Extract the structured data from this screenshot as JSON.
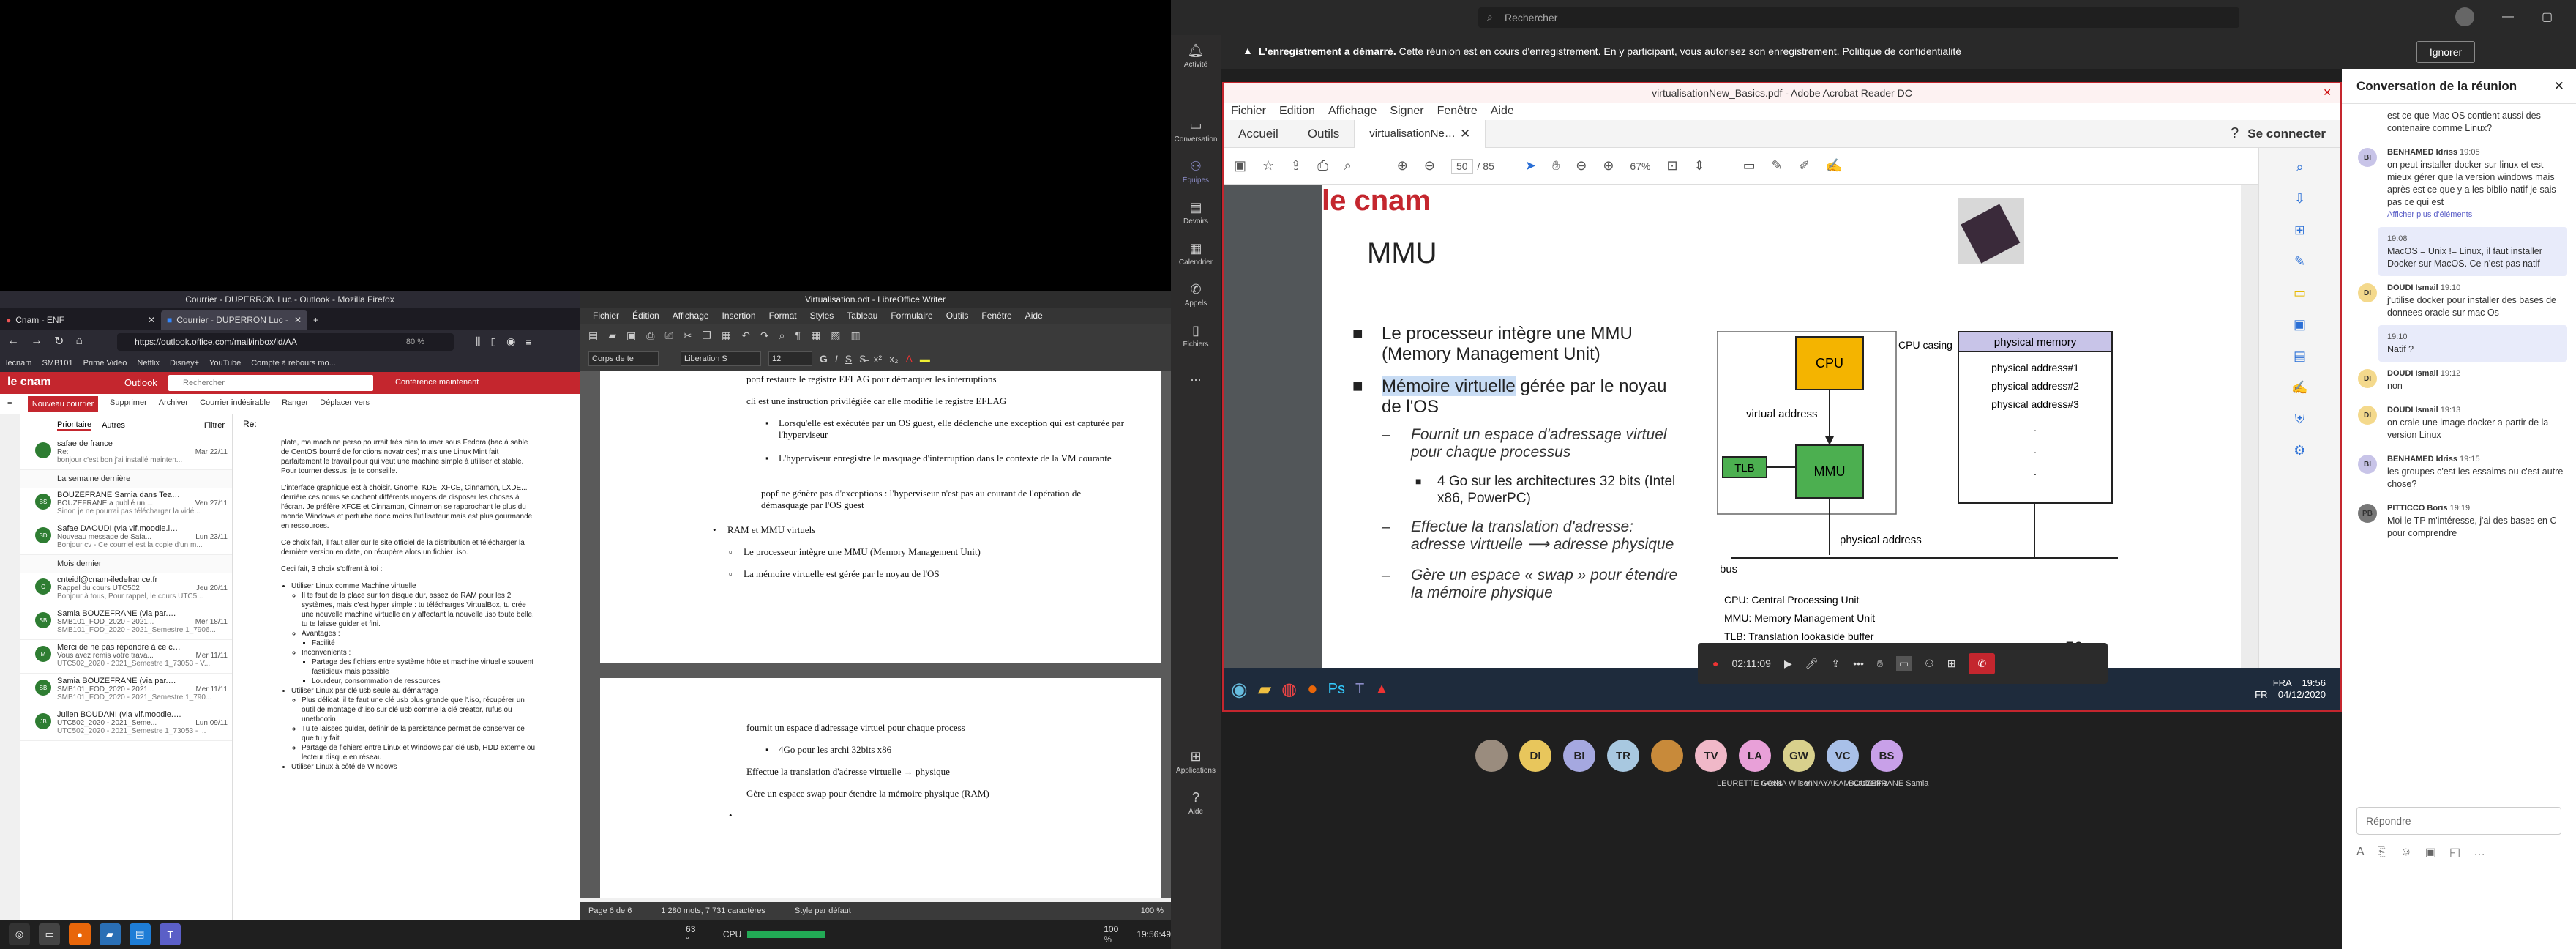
{
  "firefox": {
    "window_title": "Courrier - DUPERRON Luc - Outlook - Mozilla Firefox",
    "tabs": [
      "Cnam - ENF",
      "Courrier - DUPERRON Luc -"
    ],
    "url": "https://outlook.office.com/mail/inbox/id/AA",
    "zoom": "80 %",
    "bookmarks": [
      "lecnam",
      "SMB101",
      "Prime Video",
      "Netflix",
      "Disney+",
      "YouTube",
      "Compte à rebours mo..."
    ],
    "brand": "le cnam",
    "app": "Outlook",
    "search_placeholder": "Rechercher",
    "meeting_label": "Conférence maintenant",
    "commands": [
      "Nouveau courrier",
      "Supprimer",
      "Archiver",
      "Courrier indésirable",
      "Ranger",
      "Déplacer vers"
    ],
    "list_tabs": [
      "Prioritaire",
      "Autres",
      "Filtrer"
    ],
    "mails": [
      {
        "from": "safae de france",
        "subject": "Re:",
        "preview": "bonjour c'est bon j'ai installé mainten...",
        "date": "Mar 22/11",
        "avatar": ""
      },
      {
        "section": "La semaine dernière"
      },
      {
        "from": "BOUZEFRANE Samia dans Teams",
        "subject": "BOUZEFRANE a publié un ...",
        "preview": "Sinon je ne pourrai pas télécharger la vidé...",
        "date": "Ven 27/11",
        "avatar": "BS"
      },
      {
        "from": "Safae DAOUDI (via vlf.moodle.lecnam.net)",
        "subject": "Nouveau message de Safa...",
        "preview": "Bonjour cv - Ce courriel est la copie d'un m...",
        "date": "Lun 23/11",
        "avatar": "SD"
      },
      {
        "section": "Mois dernier"
      },
      {
        "from": "cnteidl@cnam-iledefrance.fr",
        "subject": "Rappel du cours UTC502",
        "preview": "Bonjour à tous, Pour rappel, le cours UTC5...",
        "date": "Jeu 20/11",
        "avatar": "C"
      },
      {
        "from": "Samia BOUZEFRANE (via par.moodle.lecna...",
        "subject": "SMB101_FOD_2020 - 2021...",
        "preview": "SMB101_FOD_2020 - 2021_Semestre 1_7906...",
        "date": "Mer 18/11",
        "avatar": "SB"
      },
      {
        "from": "Merci de ne pas répondre à ce courriel (via...",
        "subject": "Vous avez remis votre trava...",
        "preview": "UTC502_2020 - 2021_Semestre 1_73053 - V...",
        "date": "Mer 11/11",
        "avatar": "M"
      },
      {
        "from": "Samia BOUZEFRANE (via par.moodle.lecna...",
        "subject": "SMB101_FOD_2020 - 2021...",
        "preview": "SMB101_FOD_2020 - 2021_Semestre 1_790...",
        "date": "Mer 11/11",
        "avatar": "SB"
      },
      {
        "from": "Julien BOUDANI (via vlf.moodle.lecnam.net)",
        "subject": "UTC502_2020 - 2021_Seme...",
        "preview": "UTC502_2020 - 2021_Semestre 1_73053 - ...",
        "date": "Lun 09/11",
        "avatar": "JB"
      }
    ],
    "reading": {
      "subject": "Re:",
      "p1": "plate, ma machine perso pourrait très bien tourner sous Fedora (bac à sable de CentOS bourré de fonctions novatrices) mais une Linux Mint fait parfaitement le travail pour qui veut une machine simple à utiliser et stable. Pour tourner dessus, je te conseille.",
      "p2": "L'interface graphique est à choisir. Gnome, KDE, XFCE, Cinnamon, LXDE... derrière ces noms se cachent différents moyens de disposer les choses à l'écran. Je préfère XFCE et Cinnamon, Cinnamon se rapprochant le plus du monde Windows et perturbe donc moins l'utilisateur mais est plus gourmande en ressources.",
      "p3": "Ce choix fait, il faut aller sur le site officiel de la distribution et télécharger la dernière version en date, on récupère alors un fichier .iso.",
      "p4": "Ceci fait, 3 choix s'offrent à toi :",
      "b1": "Utiliser Linux comme Machine virtuelle",
      "b1a": "Il te faut de la place sur ton disque dur, assez de RAM pour les 2 systèmes, mais c'est hyper simple : tu télécharges VirtualBox, tu crée une nouvelle machine virtuelle en y affectant la nouvelle .iso toute belle, tu te laisse guider et fini.",
      "b1b": "Avantages :",
      "b1b1": "Facilité",
      "b1c": "Inconvenients :",
      "b1c1": "Partage des fichiers entre système hôte et machine virtuelle souvent fastidieux mais possible",
      "b1c2": "Lourdeur, consommation de ressources",
      "b2": "Utiliser Linux par clé usb seule au démarrage",
      "b2a": "Plus délicat, il te faut une clé usb plus grande que l'.iso, récupérer un outil de montage d'.iso sur clé usb comme la clé creator, rufus ou unetbootin",
      "b2b": "Tu te laisses guider, définir de la persistance permet de conserver ce que tu y fait",
      "b2c": "Partage de fichiers entre Linux et Windows par clé usb, HDD externe ou lecteur disque en réseau",
      "b3": "Utiliser Linux à côté de Windows"
    }
  },
  "writer": {
    "window_title": "Virtualisation.odt - LibreOffice Writer",
    "menus": [
      "Fichier",
      "Édition",
      "Affichage",
      "Insertion",
      "Format",
      "Styles",
      "Tableau",
      "Formulaire",
      "Outils",
      "Fenêtre",
      "Aide"
    ],
    "para_style": "Corps de te",
    "font": "Liberation S",
    "size": "12",
    "page1": {
      "l1": "popf restaure le registre EFLAG pour démarquer les interruptions",
      "l2": "cli est une instruction privilégiée car elle modifie le registre EFLAG",
      "l3": "Lorsqu'elle est exécutée par un OS guest, elle déclenche une exception qui est capturée par l'hyperviseur",
      "l4": "L'hyperviseur enregistre le masquage d'interruption dans le contexte de la VM courante",
      "l5": "popf ne génère pas d'exceptions : l'hyperviseur n'est pas au courant de l'opération de démasquage par l'OS guest",
      "l6": "RAM et MMU virtuels",
      "l7": "Le processeur intègre une MMU (Memory Management Unit)",
      "l8": "La mémoire virtuelle est gérée par le noyau de l'OS"
    },
    "page2": {
      "l1": "fournit un espace d'adressage virtuel pour chaque process",
      "l2": "4Go pour les archi 32bits x86",
      "l3": "Effectue la translation d'adresse virtuelle → physique",
      "l4": "Gère un espace swap pour étendre la mémoire physique (RAM)"
    },
    "status": {
      "page": "Page 6 de 6",
      "words": "1 280 mots, 7 731 caractères",
      "style": "Style par défaut",
      "zoom": "100 %"
    }
  },
  "taskbar_left": {
    "temp": "63 °",
    "cpu": "CPU",
    "battery": "100 %",
    "clock": "19:56:49"
  },
  "teams": {
    "search_placeholder": "Rechercher",
    "recording_bold": "L'enregistrement a démarré.",
    "recording_text": "Cette réunion est en cours d'enregistrement. En y participant, vous autorisez son enregistrement.",
    "recording_link": "Politique de confidentialité",
    "ignore": "Ignorer",
    "rail": [
      "Activité",
      "Conversation",
      "Équipes",
      "Devoirs",
      "Calendrier",
      "Appels",
      "Fichiers",
      "...",
      "Applications",
      "Aide"
    ],
    "meeting_timer": "02:11:09",
    "participants": [
      {
        "initials": "",
        "name": "",
        "color": "#9a8c7e"
      },
      {
        "initials": "DI",
        "name": "",
        "color": "#e8c65c"
      },
      {
        "initials": "BI",
        "name": "",
        "color": "#a5a8e0"
      },
      {
        "initials": "TR",
        "name": "",
        "color": "#a8c8e0"
      },
      {
        "initials": "",
        "name": "",
        "color": "#c88a3a"
      },
      {
        "initials": "TV",
        "name": "",
        "color": "#f0b8c8"
      },
      {
        "initials": "LA",
        "name": "LEURETTE Alexis",
        "color": "#e8a0d8"
      },
      {
        "initials": "GW",
        "name": "GONIA Wilson",
        "color": "#d8d08c"
      },
      {
        "initials": "VC",
        "name": "VINAYAKAM Catherine",
        "color": "#a8c0e8"
      },
      {
        "initials": "BS",
        "name": "BOUZEFRANE Samia",
        "color": "#c8a0e8"
      }
    ],
    "chat": {
      "title": "Conversation de la réunion",
      "messages": [
        {
          "author": "",
          "time": "",
          "text": "est ce que Mac OS contient aussi des contenaire comme Linux?",
          "avatar": "",
          "mine": false
        },
        {
          "author": "BENHAMED Idriss",
          "time": "19:05",
          "text": "on peut installer docker sur linux et est mieux gérer que la version windows mais après est ce que y a les biblio natif je sais pas ce qui est",
          "avatar": "BI",
          "mine": false,
          "more": "Afficher plus d'éléments"
        },
        {
          "author": "",
          "time": "19:08",
          "text": "MacOS = Unix != Linux, il faut installer Docker sur MacOS. Ce n'est pas natif",
          "avatar": "",
          "mine": true
        },
        {
          "author": "DOUDI Ismail",
          "time": "19:10",
          "text": "j'utilise docker pour installer des bases de donnees oracle sur mac Os",
          "avatar": "DI",
          "mine": false
        },
        {
          "author": "",
          "time": "19:10",
          "text": "Natif ?",
          "avatar": "",
          "mine": true
        },
        {
          "author": "DOUDI Ismail",
          "time": "19:12",
          "text": "non",
          "avatar": "DI",
          "mine": false
        },
        {
          "author": "DOUDI Ismail",
          "time": "19:13",
          "text": "on craie une image docker a partir de la version Linux",
          "avatar": "DI",
          "mine": false
        },
        {
          "author": "BENHAMED Idriss",
          "time": "19:15",
          "text": "les groupes c'est les essaims ou c'est autre chose?",
          "avatar": "BI",
          "mine": false
        },
        {
          "author": "PITTICCO Boris",
          "time": "19:19",
          "text": "Moi le TP m'intéresse, j'ai des bases en C pour comprendre",
          "avatar": "PB",
          "mine": false
        }
      ],
      "reply_placeholder": "Répondre"
    }
  },
  "acrobat": {
    "title": "virtualisationNew_Basics.pdf - Adobe Acrobat Reader DC",
    "menus": [
      "Fichier",
      "Edition",
      "Affichage",
      "Signer",
      "Fenêtre",
      "Aide"
    ],
    "tabs": [
      "Accueil",
      "Outils",
      "virtualisationNew_B..."
    ],
    "signin": "Se connecter",
    "page": "50",
    "pages_total": "/ 85",
    "zoom": "67%",
    "slide": {
      "brand": "le cnam",
      "title": "MMU",
      "b1": "Le processeur intègre une MMU (Memory Management Unit)",
      "b2_hl": "Mémoire virtuelle",
      "b2": " gérée par le noyau de l'OS",
      "s1": "Fournit un espace d'adressage virtuel pour chaque processus",
      "s1a": "4 Go sur les architectures 32 bits (Intel x86, PowerPC)",
      "s2": "Effectue la translation d'adresse: adresse virtuelle ⟶ adresse physique",
      "s3": "Gère un espace « swap » pour étendre la mémoire physique",
      "page_no": "50",
      "diagram": {
        "cpu": "CPU",
        "cpu_casing": "CPU casing",
        "virtual_address": "virtual address",
        "tlb": "TLB",
        "mmu": "MMU",
        "physical_address": "physical address",
        "bus": "bus",
        "physical_memory": "physical memory",
        "pm_rows": [
          "physical address#1",
          "physical address#2",
          "physical address#3"
        ],
        "legend": [
          "CPU: Central Processing Unit",
          "MMU: Memory Management Unit",
          "TLB: Translation lookaside buffer"
        ],
        "colors": {
          "cpu": "#f4b400",
          "mmu": "#4caf50",
          "tlb": "#4caf50",
          "pm_header": "#c8c4e8"
        }
      }
    },
    "taskbar": {
      "lang": "FRA",
      "lang2": "FR",
      "time": "19:56",
      "date": "04/12/2020"
    }
  }
}
